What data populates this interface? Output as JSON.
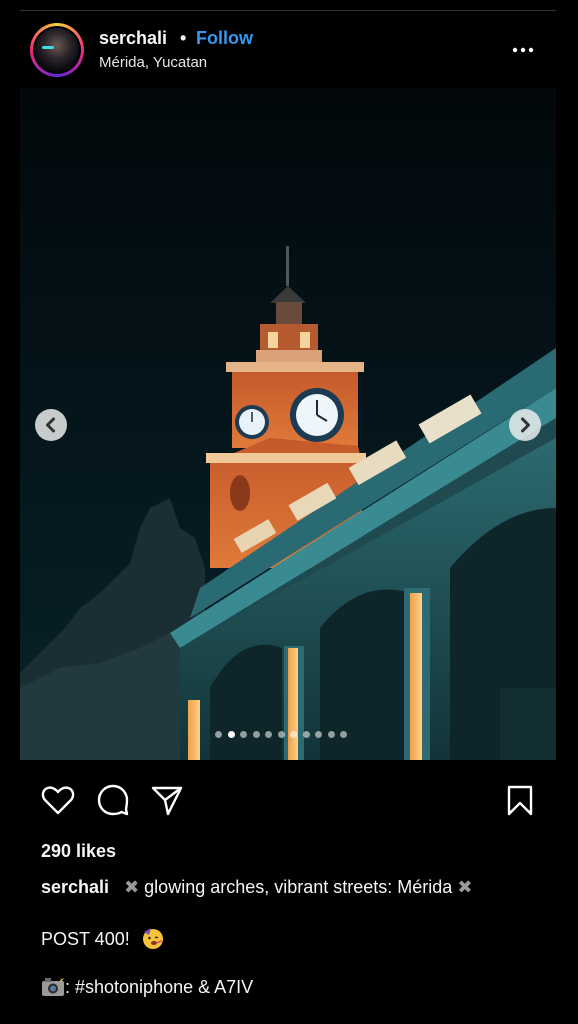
{
  "post": {
    "username": "serchali",
    "separator": "•",
    "follow_label": "Follow",
    "location": "Mérida, Yucatan",
    "more_icon": "more-horizontal-icon"
  },
  "carousel": {
    "slide_count": 11,
    "active_index": 1,
    "prev_icon": "chevron-left-icon",
    "next_icon": "chevron-right-icon"
  },
  "actions": {
    "like_icon": "heart-icon",
    "comment_icon": "comment-icon",
    "share_icon": "send-icon",
    "save_icon": "bookmark-icon"
  },
  "likes_text": "290 likes",
  "caption": {
    "username": "serchali",
    "mark": "✖",
    "text": "glowing arches, vibrant streets: Mérida",
    "mark_end": "✖"
  },
  "post_line": "POST 400!",
  "camera_line": ": #shotoniphone & A7IV",
  "colors": {
    "background": "#000000",
    "link": "#3897f0",
    "text": "#f5f5f5"
  }
}
